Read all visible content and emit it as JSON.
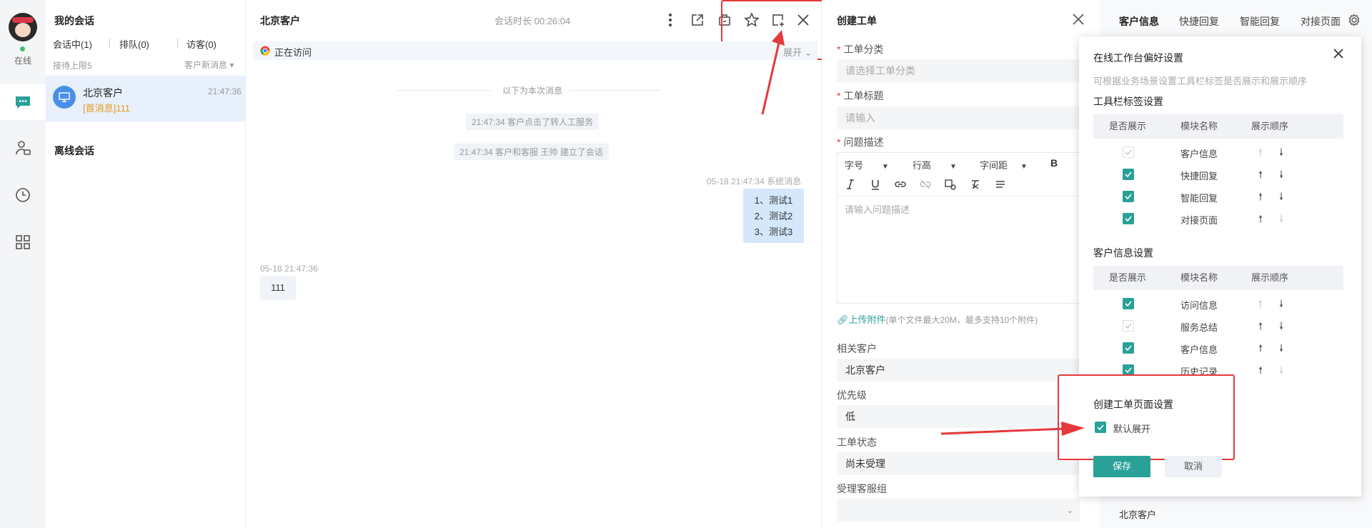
{
  "rail": {
    "status": "在线"
  },
  "conversations": {
    "title": "我的会话",
    "tabs": [
      "会话中(1)",
      "排队(0)",
      "访客(0)"
    ],
    "limit": "接待上限5",
    "new_msg": "客户新消息",
    "item": {
      "name": "北京客户",
      "time": "21:47:36",
      "preview": "[首消息]111"
    },
    "offline_title": "离线会话"
  },
  "chat": {
    "customer": "北京客户",
    "duration": "会话时长 00:26:04",
    "visiting": "正在访问",
    "expand": "展开",
    "divider": "以下为本次消息",
    "sys1": "21:47:34 客户点击了转人工服务",
    "sys2": "21:47:34 客户和客服 王帅 建立了会话",
    "right_meta": "05-18 21:47:34  系统消息",
    "right_lines": [
      "1、测试1",
      "2、测试2",
      "3、测试3"
    ],
    "left_meta": "05-18 21:47:36",
    "left_msg": "111"
  },
  "workorder": {
    "title": "创建工单",
    "category_label": "工单分类",
    "category_ph": "请选择工单分类",
    "title_label": "工单标题",
    "title_ph": "请输入",
    "desc_label": "问题描述",
    "font_size": "字号",
    "line_height": "行高",
    "letter_spacing": "字间距",
    "bold": "B",
    "desc_ph": "请输入问题描述",
    "upload": "上传附件",
    "upload_hint": "(单个文件最大20M，最多支持10个附件)",
    "related_label": "相关客户",
    "related_value": "北京客户",
    "priority_label": "优先级",
    "priority_value": "低",
    "status_label": "工单状态",
    "status_value": "尚未受理",
    "group_label": "受理客服组"
  },
  "right_tabs": [
    "客户信息",
    "快捷回复",
    "智能回复",
    "对接页面"
  ],
  "right_bottom": "北京客户",
  "popup": {
    "title": "在线工作台偏好设置",
    "subtitle": "可根据业务场景设置工具栏标签是否展示和展示顺序",
    "section1": "工具栏标签设置",
    "section2": "客户信息设置",
    "section3": "创建工单页面设置",
    "col_show": "是否展示",
    "col_name": "模块名称",
    "col_order": "展示顺序",
    "toolbar_rows": [
      "客户信息",
      "快捷回复",
      "智能回复",
      "对接页面"
    ],
    "info_rows": [
      "访问信息",
      "服务总结",
      "客户信息",
      "历史记录"
    ],
    "default_expand": "默认展开",
    "save": "保存",
    "cancel": "取消"
  },
  "colors": {
    "accent": "#2aa198",
    "highlight": "#e4393c",
    "selected": "#e7f0fb"
  }
}
